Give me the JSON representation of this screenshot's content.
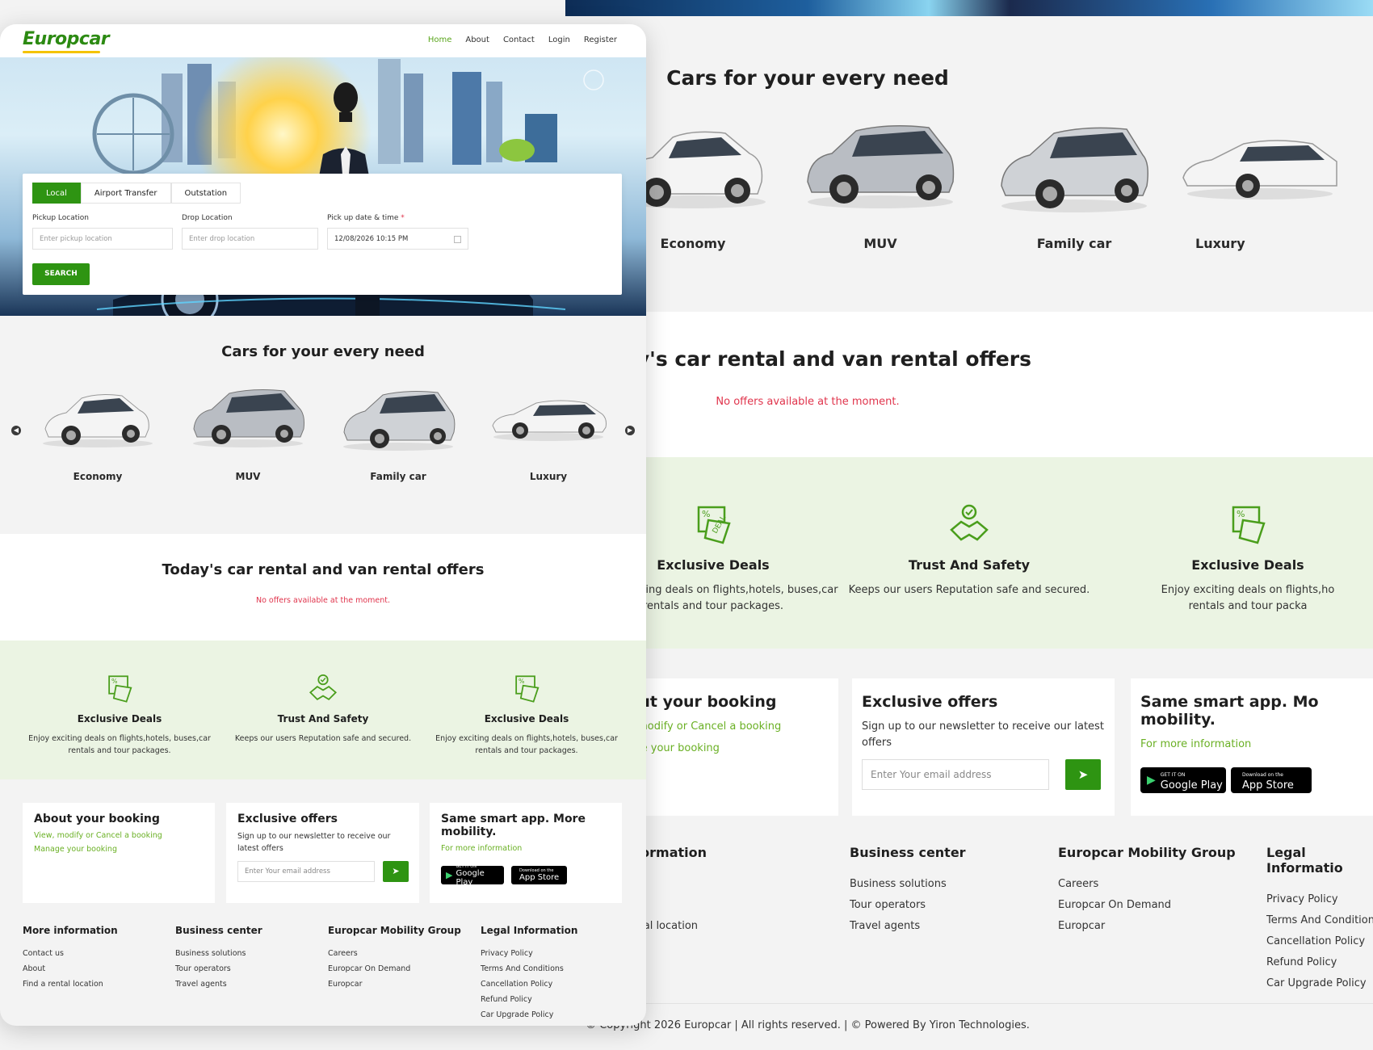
{
  "brand": {
    "logo": "Europcar",
    "primary": "#2e9412",
    "accent_link": "#6ab024",
    "alert": "#e0344c",
    "feature_bg": "#ebf4e3"
  },
  "nav": {
    "items": [
      "Home",
      "About",
      "Contact",
      "Login",
      "Register"
    ],
    "active": "Home"
  },
  "search": {
    "tabs": [
      "Local",
      "Airport Transfer",
      "Outstation"
    ],
    "active_tab": "Local",
    "pickup_label": "Pickup Location",
    "pickup_placeholder": "Enter pickup location",
    "drop_label": "Drop Location",
    "drop_placeholder": "Enter drop location",
    "datetime_label": "Pick up date & time",
    "datetime_required": "*",
    "datetime_value": "12/08/2026 10:15 PM",
    "button": "SEARCH"
  },
  "cars": {
    "title": "Cars for your every need",
    "items": [
      "Economy",
      "MUV",
      "Family car",
      "Luxury"
    ],
    "prev_icon": "chevron-left-icon",
    "next_icon": "chevron-right-icon"
  },
  "offers": {
    "title": "Today's car rental and van rental offers",
    "empty": "No offers available at the moment."
  },
  "features": [
    {
      "icon": "deal-tag-icon",
      "title": "Exclusive Deals",
      "text": "Enjoy exciting deals on flights,hotels, buses,car rentals and tour packages."
    },
    {
      "icon": "handshake-icon",
      "title": "Trust And Safety",
      "text": "Keeps our users Reputation safe and secured."
    },
    {
      "icon": "deal-tag-icon",
      "title": "Exclusive Deals",
      "text": "Enjoy exciting deals on flights,hotels, buses,car rentals and tour packages."
    }
  ],
  "features_bg": {
    "third_title": "Exclusive Deals",
    "third_line1": "Enjoy exciting deals on flights,ho",
    "third_line2": "rentals and tour packa"
  },
  "booking": {
    "title": "About your booking",
    "link1": "View, modify or Cancel a booking",
    "link2": "Manage your booking"
  },
  "newsletter": {
    "title": "Exclusive offers",
    "text": "Sign up to our newsletter to receive our latest offers",
    "placeholder": "Enter Your email address",
    "send_icon": "send-icon"
  },
  "app": {
    "title": "Same smart app. More mobility.",
    "title_bg": "Same smart app. Mo",
    "title_bg2": "mobility.",
    "link": "For more information",
    "google_small": "GET IT ON",
    "google": "Google Play",
    "apple_small": "Download on the",
    "apple": "App Store",
    "apple_bg_small": "Download on the",
    "apple_bg": "App Store"
  },
  "footer": {
    "cols": [
      {
        "heading": "More information",
        "items": [
          "Contact us",
          "About",
          "Find a rental location"
        ]
      },
      {
        "heading": "Business center",
        "items": [
          "Business solutions",
          "Tour operators",
          "Travel agents"
        ]
      },
      {
        "heading": "Europcar Mobility Group",
        "items": [
          "Careers",
          "Europcar On Demand",
          "Europcar"
        ]
      },
      {
        "heading": "Legal Information",
        "items": [
          "Privacy Policy",
          "Terms And Conditions",
          "Cancellation Policy",
          "Refund Policy",
          "Car Upgrade Policy"
        ]
      }
    ],
    "bg_col1_heading": "ore information",
    "bg_col1_items": [
      "ontact us",
      "bout",
      "ind a rental location"
    ],
    "bg_legal_heading": "Legal Informatio",
    "bg_legal_item2": "Terms And Condition",
    "bg_luxury": "Luxury",
    "copyright": "© Copyright 2026 Europcar | All rights reserved. | © Powered By Yiron Technologies."
  }
}
